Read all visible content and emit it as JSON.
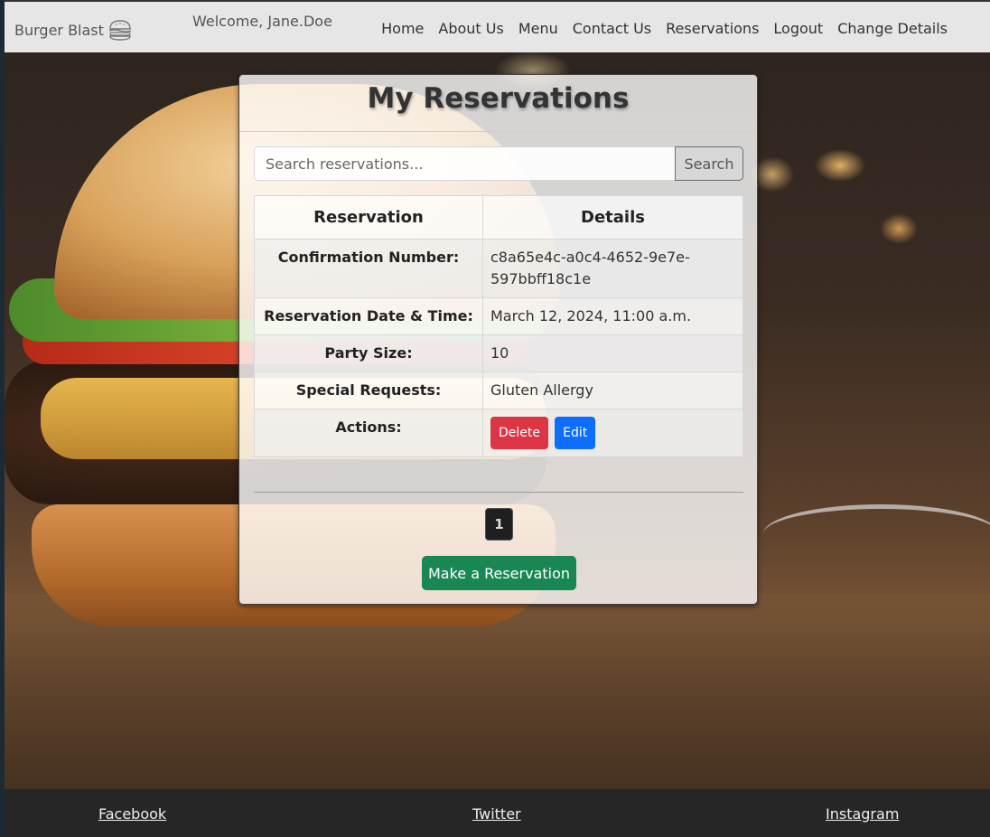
{
  "navbar": {
    "brand": "Burger Blast",
    "brand_icon": "burger-icon",
    "welcome": "Welcome, Jane.Doe",
    "links": [
      "Home",
      "About Us",
      "Menu",
      "Contact Us",
      "Reservations",
      "Logout",
      "Change Details"
    ]
  },
  "card": {
    "title": "My Reservations",
    "search": {
      "placeholder": "Search reservations...",
      "button": "Search"
    },
    "table": {
      "headers": [
        "Reservation",
        "Details"
      ],
      "rows": [
        {
          "label": "Confirmation Number:",
          "value": "c8a65e4c-a0c4-4652-9e7e-597bbff18c1e"
        },
        {
          "label": "Reservation Date & Time:",
          "value": "March 12, 2024, 11:00 a.m."
        },
        {
          "label": "Party Size:",
          "value": "10"
        },
        {
          "label": "Special Requests:",
          "value": "Gluten Allergy"
        },
        {
          "label": "Actions:"
        }
      ],
      "actions": {
        "delete": "Delete",
        "edit": "Edit"
      }
    },
    "pagination": {
      "current_page": "1"
    },
    "make_button": "Make a Reservation"
  },
  "footer": {
    "links": [
      "Facebook",
      "Twitter",
      "Instagram"
    ]
  },
  "colors": {
    "delete": "#dc3545",
    "edit": "#0d6efd",
    "make_reservation": "#198754",
    "footer_bg": "#262626"
  }
}
